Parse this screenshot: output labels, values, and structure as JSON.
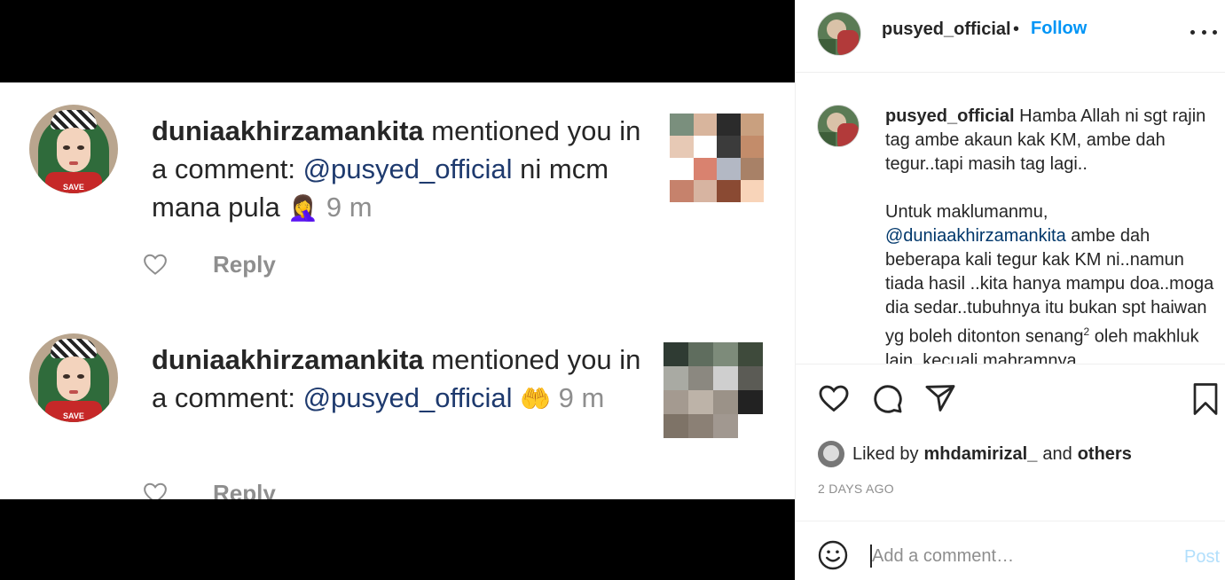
{
  "notifications": [
    {
      "username": "duniaakhirzamankita",
      "text_after_user": " mentioned you in a comment: ",
      "mention": "@pusyed_official",
      "message": " ni mcm mana pula ",
      "emoji": "🤦‍♀️",
      "time": " 9 m",
      "reply_label": "Reply",
      "avatar_text": "SAVE"
    },
    {
      "username": "duniaakhirzamankita",
      "text_after_user": " mentioned you in a comment: ",
      "mention": "@pusyed_official",
      "message": " ",
      "emoji": "🤲",
      "time": " 9 m",
      "reply_label": "Reply",
      "avatar_text": "SAVE"
    }
  ],
  "post": {
    "author": "pusyed_official",
    "separator": "•",
    "follow_label": "Follow",
    "caption_user": "pusyed_official",
    "caption_line1": " Hamba Allah ni sgt rajin tag ambe akaun kak KM, ambe dah tegur..tapi masih tag lagi..",
    "caption_para2_prefix": "Untuk maklumanmu,",
    "caption_mention": "@duniaakhirzamankita",
    "caption_para2_rest": " ambe dah beberapa kali tegur kak KM ni..namun tiada hasil ..kita hanya mampu doa..moga dia sedar..tubuhnya itu bukan spt haiwan yg boleh ditonton senang",
    "caption_superscript": "2",
    "caption_tail": " oleh makhluk lain, kecuali mahramnya",
    "liked_prefix": "Liked by",
    "liked_user": "mhdamirizal_",
    "liked_and": "and",
    "liked_others": "others",
    "time_ago": "2 DAYS AGO",
    "comment_placeholder": "Add a comment…",
    "post_label": "Post"
  },
  "icons": {
    "like": "heart-icon",
    "comment": "comment-icon",
    "share": "paper-plane-icon",
    "save": "bookmark-icon",
    "emoji": "smiley-icon",
    "more": "more-options-icon"
  },
  "colors": {
    "link_blue": "#0095f6",
    "mention_blue": "#00376b",
    "muted": "#8e8e8e",
    "post_disabled": "#b2dffc"
  }
}
